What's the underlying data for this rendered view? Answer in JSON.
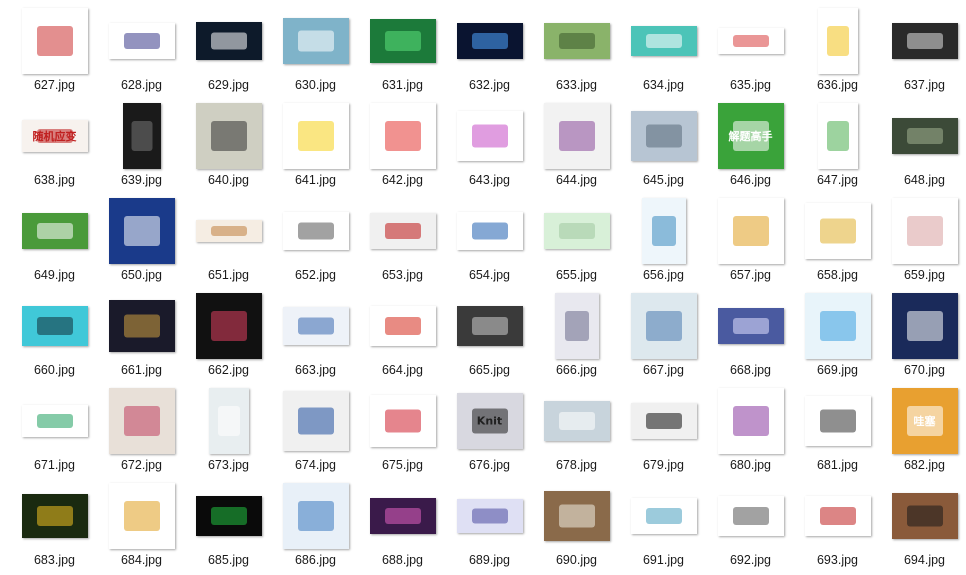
{
  "files": [
    {
      "name": "627.jpg",
      "w": 66,
      "h": 66,
      "bg": "#ffffff",
      "fg": "#cc3333",
      "icon": "colorblind-test-icon"
    },
    {
      "name": "628.jpg",
      "w": 66,
      "h": 36,
      "bg": "#ffffff",
      "fg": "#3a3a8a",
      "icon": "scatter-plot-icon"
    },
    {
      "name": "629.jpg",
      "w": 66,
      "h": 38,
      "bg": "#0d1a2a",
      "fg": "#ffffff",
      "icon": "padlock-icon"
    },
    {
      "name": "630.jpg",
      "w": 66,
      "h": 46,
      "bg": "#7fb3c9",
      "fg": "#ffffff",
      "icon": "binary-tech-icon"
    },
    {
      "name": "631.jpg",
      "w": 66,
      "h": 44,
      "bg": "#1c7a3a",
      "fg": "#5be07a",
      "icon": "matrix-grid-icon"
    },
    {
      "name": "632.jpg",
      "w": 66,
      "h": 36,
      "bg": "#0a1430",
      "fg": "#4da3ff",
      "icon": "blue-lights-icon"
    },
    {
      "name": "633.jpg",
      "w": 66,
      "h": 36,
      "bg": "#8ab36a",
      "fg": "#3a5a2a",
      "icon": "landscape-icon"
    },
    {
      "name": "634.jpg",
      "w": 66,
      "h": 30,
      "bg": "#4cc4b8",
      "fg": "#ffffff",
      "icon": "flowchart-icon"
    },
    {
      "name": "635.jpg",
      "w": 66,
      "h": 26,
      "bg": "#ffffff",
      "fg": "#d94040",
      "icon": "tree-diagram-icon"
    },
    {
      "name": "636.jpg",
      "w": 40,
      "h": 66,
      "bg": "#ffffff",
      "fg": "#f2c21b",
      "icon": "duck-face-icon"
    },
    {
      "name": "637.jpg",
      "w": 66,
      "h": 36,
      "bg": "#2a2a2a",
      "fg": "#e0e0e0",
      "icon": "crossed-arrows-icon"
    },
    {
      "name": "638.jpg",
      "w": 66,
      "h": 32,
      "bg": "#f7f2ee",
      "fg": "#c02020",
      "text": "随机应变",
      "icon": "chinese-text-icon"
    },
    {
      "name": "639.jpg",
      "w": 38,
      "h": 66,
      "bg": "#1a1a1a",
      "fg": "#777777",
      "icon": "phone-screen-icon"
    },
    {
      "name": "640.jpg",
      "w": 66,
      "h": 66,
      "bg": "#cfcfc2",
      "fg": "#333333",
      "icon": "sudoku-grid-icon"
    },
    {
      "name": "641.jpg",
      "w": 66,
      "h": 66,
      "bg": "#ffffff",
      "fg": "#f5d21b",
      "icon": "yellow-book-icon"
    },
    {
      "name": "642.jpg",
      "w": 66,
      "h": 66,
      "bg": "#ffffff",
      "fg": "#e53935",
      "icon": "prize-wheel-icon"
    },
    {
      "name": "643.jpg",
      "w": 66,
      "h": 50,
      "bg": "#ffffff",
      "fg": "#c74dc7",
      "icon": "pie-chart-icon"
    },
    {
      "name": "644.jpg",
      "w": 66,
      "h": 66,
      "bg": "#f2f2f2",
      "fg": "#8a4a9a",
      "icon": "keys-icon"
    },
    {
      "name": "645.jpg",
      "w": 66,
      "h": 50,
      "bg": "#b7c5d3",
      "fg": "#5a6a7a",
      "icon": "photo-collage-icon"
    },
    {
      "name": "646.jpg",
      "w": 66,
      "h": 66,
      "bg": "#3aa33a",
      "fg": "#ffffff",
      "text": "解题高手",
      "icon": "green-book-icon"
    },
    {
      "name": "647.jpg",
      "w": 40,
      "h": 66,
      "bg": "#ffffff",
      "fg": "#4caf50",
      "icon": "mobile-app-icon"
    },
    {
      "name": "648.jpg",
      "w": 66,
      "h": 36,
      "bg": "#3c4a38",
      "fg": "#a0b090",
      "icon": "checker-board-icon"
    },
    {
      "name": "649.jpg",
      "w": 66,
      "h": 36,
      "bg": "#4a9a3a",
      "fg": "#ffffff",
      "icon": "game-window-icon"
    },
    {
      "name": "650.jpg",
      "w": 66,
      "h": 66,
      "bg": "#1a3a8a",
      "fg": "#ffffff",
      "icon": "blue-book-cover-icon"
    },
    {
      "name": "651.jpg",
      "w": 66,
      "h": 22,
      "bg": "#f5ede3",
      "fg": "#c08040",
      "icon": "banner-icon"
    },
    {
      "name": "652.jpg",
      "w": 66,
      "h": 38,
      "bg": "#ffffff",
      "fg": "#555555",
      "icon": "document-table-icon"
    },
    {
      "name": "653.jpg",
      "w": 66,
      "h": 36,
      "bg": "#f0f0f0",
      "fg": "#c01818",
      "icon": "web-page-icon"
    },
    {
      "name": "654.jpg",
      "w": 66,
      "h": 38,
      "bg": "#ffffff",
      "fg": "#2060b0",
      "icon": "decay-curve-icon"
    },
    {
      "name": "655.jpg",
      "w": 66,
      "h": 36,
      "bg": "#d8f0d8",
      "fg": "#a0c8a0",
      "icon": "blank-green-icon"
    },
    {
      "name": "656.jpg",
      "w": 44,
      "h": 66,
      "bg": "#eef6fb",
      "fg": "#3a8ac0",
      "icon": "infographic-icon"
    },
    {
      "name": "657.jpg",
      "w": 66,
      "h": 66,
      "bg": "#ffffff",
      "fg": "#e0a020",
      "icon": "colorful-cubes-icon"
    },
    {
      "name": "658.jpg",
      "w": 66,
      "h": 56,
      "bg": "#ffffff",
      "fg": "#e0b030",
      "icon": "node-tree-icon"
    },
    {
      "name": "659.jpg",
      "w": 66,
      "h": 66,
      "bg": "#ffffff",
      "fg": "#d8a0a0",
      "icon": "medical-diagram-icon"
    },
    {
      "name": "660.jpg",
      "w": 66,
      "h": 40,
      "bg": "#40c8d8",
      "fg": "#10303a",
      "icon": "terminal-icon"
    },
    {
      "name": "661.jpg",
      "w": 66,
      "h": 52,
      "bg": "#1a1a2a",
      "fg": "#d0a040",
      "icon": "dark-dashboard-icon"
    },
    {
      "name": "662.jpg",
      "w": 66,
      "h": 66,
      "bg": "#111111",
      "fg": "#e04060",
      "icon": "laptop-sleeve-icon"
    },
    {
      "name": "663.jpg",
      "w": 66,
      "h": 38,
      "bg": "#eef2f8",
      "fg": "#3a6ab0",
      "icon": "web-interface-icon"
    },
    {
      "name": "664.jpg",
      "w": 66,
      "h": 40,
      "bg": "#ffffff",
      "fg": "#d52b1e",
      "icon": "canada-flag-icon"
    },
    {
      "name": "665.jpg",
      "w": 66,
      "h": 40,
      "bg": "#3a3a3a",
      "fg": "#cccccc",
      "icon": "dark-slide-icon"
    },
    {
      "name": "666.jpg",
      "w": 44,
      "h": 66,
      "bg": "#e8e8ef",
      "fg": "#6a6a8a",
      "icon": "poster-people-icon"
    },
    {
      "name": "667.jpg",
      "w": 66,
      "h": 66,
      "bg": "#dde8ee",
      "fg": "#4a7ab0",
      "icon": "scarf-icon"
    },
    {
      "name": "668.jpg",
      "w": 66,
      "h": 36,
      "bg": "#4a5aa0",
      "fg": "#e0e0ff",
      "icon": "web-banner-icon"
    },
    {
      "name": "669.jpg",
      "w": 66,
      "h": 66,
      "bg": "#e8f4fa",
      "fg": "#3aa0e0",
      "icon": "clock-toy-icon"
    },
    {
      "name": "670.jpg",
      "w": 66,
      "h": 66,
      "bg": "#1a2a5a",
      "fg": "#ffffff",
      "icon": "navy-book-icon"
    },
    {
      "name": "671.jpg",
      "w": 66,
      "h": 32,
      "bg": "#ffffff",
      "fg": "#20a060",
      "icon": "line-graph-icon"
    },
    {
      "name": "672.jpg",
      "w": 66,
      "h": 66,
      "bg": "#e8e0d8",
      "fg": "#c04060",
      "icon": "craft-circles-icon"
    },
    {
      "name": "673.jpg",
      "w": 40,
      "h": 66,
      "bg": "#e8eef0",
      "fg": "#ffffff",
      "icon": "water-cup-icon"
    },
    {
      "name": "674.jpg",
      "w": 66,
      "h": 60,
      "bg": "#f0f0f0",
      "fg": "#2050a0",
      "icon": "software-dialog-icon"
    },
    {
      "name": "675.jpg",
      "w": 66,
      "h": 52,
      "bg": "#ffffff",
      "fg": "#d02030",
      "icon": "dice-icon"
    },
    {
      "name": "676.jpg",
      "w": 66,
      "h": 56,
      "bg": "#d8d8e0",
      "fg": "#202020",
      "text": "Knit",
      "icon": "fashion-model-icon"
    },
    {
      "name": "678.jpg",
      "w": 66,
      "h": 40,
      "bg": "#c8d4dc",
      "fg": "#ffffff",
      "icon": "robot-hand-icon"
    },
    {
      "name": "679.jpg",
      "w": 66,
      "h": 36,
      "bg": "#f0f0f0",
      "fg": "#101010",
      "icon": "ide-window-icon"
    },
    {
      "name": "680.jpg",
      "w": 66,
      "h": 66,
      "bg": "#ffffff",
      "fg": "#8a3aa0",
      "icon": "lingerie-icon"
    },
    {
      "name": "681.jpg",
      "w": 66,
      "h": 50,
      "bg": "#ffffff",
      "fg": "#333333",
      "icon": "product-photo-icon"
    },
    {
      "name": "682.jpg",
      "w": 66,
      "h": 66,
      "bg": "#e8a030",
      "fg": "#ffffff",
      "text": "哇塞",
      "icon": "chick-face-icon"
    },
    {
      "name": "683.jpg",
      "w": 66,
      "h": 44,
      "bg": "#1a2a10",
      "fg": "#f0c020",
      "icon": "flower-icon"
    },
    {
      "name": "684.jpg",
      "w": 66,
      "h": 66,
      "bg": "#ffffff",
      "fg": "#e0a020",
      "icon": "battery-icon"
    },
    {
      "name": "685.jpg",
      "w": 66,
      "h": 40,
      "bg": "#0a0a0a",
      "fg": "#20c040",
      "icon": "stock-chart-icon"
    },
    {
      "name": "686.jpg",
      "w": 66,
      "h": 66,
      "bg": "#e8f0f8",
      "fg": "#3a7ac0",
      "icon": "open-book-icon"
    },
    {
      "name": "688.jpg",
      "w": 66,
      "h": 36,
      "bg": "#3a1a4a",
      "fg": "#e060c0",
      "icon": "game-scene-icon"
    },
    {
      "name": "689.jpg",
      "w": 66,
      "h": 34,
      "bg": "#dfe0f4",
      "fg": "#4a4aa0",
      "icon": "app-window-icon"
    },
    {
      "name": "690.jpg",
      "w": 66,
      "h": 50,
      "bg": "#8a6a4a",
      "fg": "#f0ece2",
      "icon": "book-pages-icon"
    },
    {
      "name": "691.jpg",
      "w": 66,
      "h": 36,
      "bg": "#ffffff",
      "fg": "#4aa0c0",
      "icon": "ear-buds-icon"
    },
    {
      "name": "692.jpg",
      "w": 66,
      "h": 40,
      "bg": "#ffffff",
      "fg": "#555555",
      "icon": "circuit-diagram-icon"
    },
    {
      "name": "693.jpg",
      "w": 66,
      "h": 40,
      "bg": "#ffffff",
      "fg": "#c02020",
      "icon": "helicopter-icon"
    },
    {
      "name": "694.jpg",
      "w": 66,
      "h": 46,
      "bg": "#8a5a3a",
      "fg": "#1a1a1a",
      "icon": "earphone-case-icon"
    }
  ]
}
